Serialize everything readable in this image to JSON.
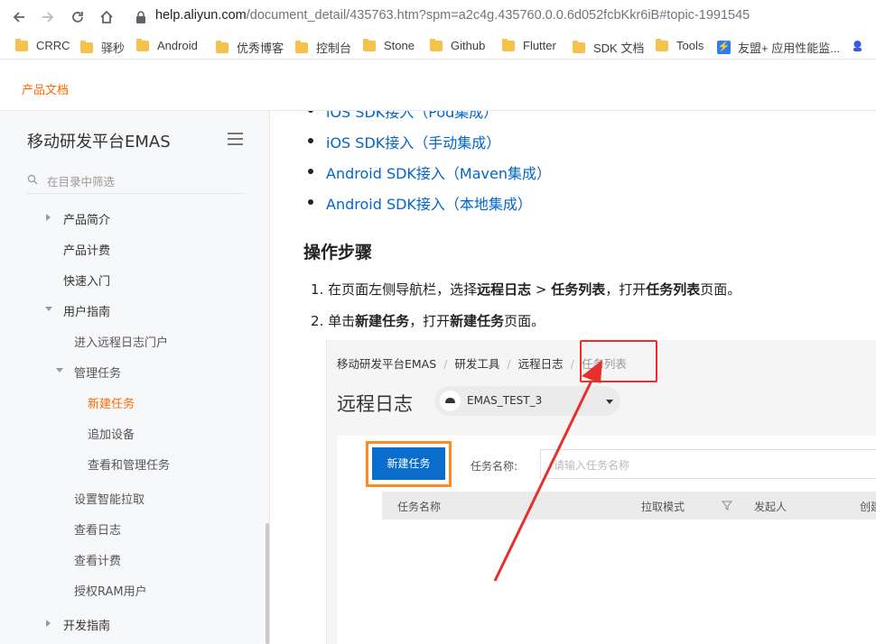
{
  "browser": {
    "url_host": "help.aliyun.com",
    "url_rest": "/document_detail/435763.htm?spm=a2c4g.435760.0.0.6d052fcbKkr6iB#topic-1991545",
    "bookmarks": [
      "CRRC",
      "驿秒",
      "Android",
      "优秀博客",
      "控制台",
      "Stone",
      "Github",
      "Flutter",
      "SDK 文档",
      "Tools",
      "友盟+ 应用性能监..."
    ]
  },
  "site": {
    "title": "产品文档"
  },
  "sidebar": {
    "title": "移动研发平台EMAS",
    "filter_placeholder": "在目录中筛选",
    "items": [
      {
        "label": "产品简介"
      },
      {
        "label": "产品计费"
      },
      {
        "label": "快速入门"
      },
      {
        "label": "用户指南"
      },
      {
        "label": "进入远程日志门户"
      },
      {
        "label": "管理任务"
      },
      {
        "label": "新建任务"
      },
      {
        "label": "追加设备"
      },
      {
        "label": "查看和管理任务"
      },
      {
        "label": "设置智能拉取"
      },
      {
        "label": "查看日志"
      },
      {
        "label": "查看计费"
      },
      {
        "label": "授权RAM用户"
      },
      {
        "label": "开发指南"
      }
    ]
  },
  "main": {
    "partial_link": "iOS SDK接入（Pod集成）",
    "links": [
      "iOS SDK接入（手动集成）",
      "Android SDK接入（Maven集成）",
      "Android SDK接入（本地集成）"
    ],
    "heading": "操作步骤",
    "step1": {
      "num": "1.",
      "a": "在页面左侧导航栏，选择",
      "b": "远程日志",
      "c": " > ",
      "d": "任务列表",
      "e": "，打开",
      "f": "任务列表",
      "g": "页面。"
    },
    "step2": {
      "num": "2.",
      "a": "单击",
      "b": "新建任务",
      "c": "，打开",
      "d": "新建任务",
      "e": "页面。"
    }
  },
  "screenshot": {
    "crumbs": [
      "移动研发平台EMAS",
      "研发工具",
      "远程日志",
      "任务列表"
    ],
    "title": "远程日志",
    "env": "EMAS_TEST_3",
    "new_task_button": "新建任务",
    "task_name_label": "任务名称:",
    "task_name_placeholder": "请输入任务名称",
    "columns": [
      "任务名称",
      "拉取模式",
      "发起人",
      "创建"
    ]
  },
  "colors": {
    "accent": "#ff6a00",
    "link": "#0066cc",
    "highlight_red": "#e5302b",
    "highlight_orange": "#ff8a1f",
    "button_blue": "#0a6ccb"
  }
}
